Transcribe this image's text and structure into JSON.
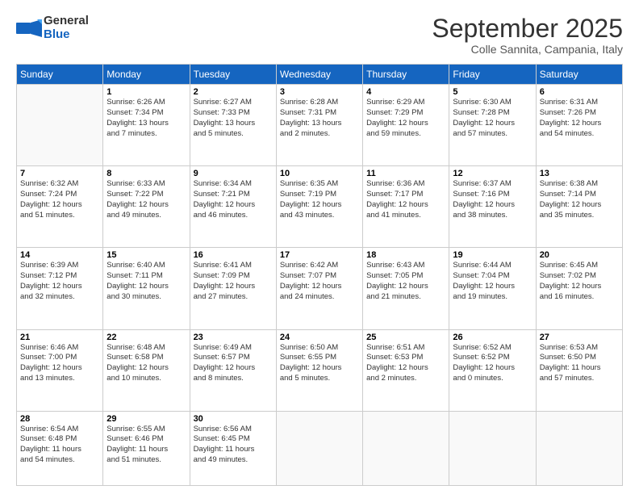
{
  "header": {
    "logo_line1": "General",
    "logo_line2": "Blue",
    "month": "September 2025",
    "location": "Colle Sannita, Campania, Italy"
  },
  "days_of_week": [
    "Sunday",
    "Monday",
    "Tuesday",
    "Wednesday",
    "Thursday",
    "Friday",
    "Saturday"
  ],
  "weeks": [
    [
      {
        "day": "",
        "info": ""
      },
      {
        "day": "1",
        "info": "Sunrise: 6:26 AM\nSunset: 7:34 PM\nDaylight: 13 hours\nand 7 minutes."
      },
      {
        "day": "2",
        "info": "Sunrise: 6:27 AM\nSunset: 7:33 PM\nDaylight: 13 hours\nand 5 minutes."
      },
      {
        "day": "3",
        "info": "Sunrise: 6:28 AM\nSunset: 7:31 PM\nDaylight: 13 hours\nand 2 minutes."
      },
      {
        "day": "4",
        "info": "Sunrise: 6:29 AM\nSunset: 7:29 PM\nDaylight: 12 hours\nand 59 minutes."
      },
      {
        "day": "5",
        "info": "Sunrise: 6:30 AM\nSunset: 7:28 PM\nDaylight: 12 hours\nand 57 minutes."
      },
      {
        "day": "6",
        "info": "Sunrise: 6:31 AM\nSunset: 7:26 PM\nDaylight: 12 hours\nand 54 minutes."
      }
    ],
    [
      {
        "day": "7",
        "info": "Sunrise: 6:32 AM\nSunset: 7:24 PM\nDaylight: 12 hours\nand 51 minutes."
      },
      {
        "day": "8",
        "info": "Sunrise: 6:33 AM\nSunset: 7:22 PM\nDaylight: 12 hours\nand 49 minutes."
      },
      {
        "day": "9",
        "info": "Sunrise: 6:34 AM\nSunset: 7:21 PM\nDaylight: 12 hours\nand 46 minutes."
      },
      {
        "day": "10",
        "info": "Sunrise: 6:35 AM\nSunset: 7:19 PM\nDaylight: 12 hours\nand 43 minutes."
      },
      {
        "day": "11",
        "info": "Sunrise: 6:36 AM\nSunset: 7:17 PM\nDaylight: 12 hours\nand 41 minutes."
      },
      {
        "day": "12",
        "info": "Sunrise: 6:37 AM\nSunset: 7:16 PM\nDaylight: 12 hours\nand 38 minutes."
      },
      {
        "day": "13",
        "info": "Sunrise: 6:38 AM\nSunset: 7:14 PM\nDaylight: 12 hours\nand 35 minutes."
      }
    ],
    [
      {
        "day": "14",
        "info": "Sunrise: 6:39 AM\nSunset: 7:12 PM\nDaylight: 12 hours\nand 32 minutes."
      },
      {
        "day": "15",
        "info": "Sunrise: 6:40 AM\nSunset: 7:11 PM\nDaylight: 12 hours\nand 30 minutes."
      },
      {
        "day": "16",
        "info": "Sunrise: 6:41 AM\nSunset: 7:09 PM\nDaylight: 12 hours\nand 27 minutes."
      },
      {
        "day": "17",
        "info": "Sunrise: 6:42 AM\nSunset: 7:07 PM\nDaylight: 12 hours\nand 24 minutes."
      },
      {
        "day": "18",
        "info": "Sunrise: 6:43 AM\nSunset: 7:05 PM\nDaylight: 12 hours\nand 21 minutes."
      },
      {
        "day": "19",
        "info": "Sunrise: 6:44 AM\nSunset: 7:04 PM\nDaylight: 12 hours\nand 19 minutes."
      },
      {
        "day": "20",
        "info": "Sunrise: 6:45 AM\nSunset: 7:02 PM\nDaylight: 12 hours\nand 16 minutes."
      }
    ],
    [
      {
        "day": "21",
        "info": "Sunrise: 6:46 AM\nSunset: 7:00 PM\nDaylight: 12 hours\nand 13 minutes."
      },
      {
        "day": "22",
        "info": "Sunrise: 6:48 AM\nSunset: 6:58 PM\nDaylight: 12 hours\nand 10 minutes."
      },
      {
        "day": "23",
        "info": "Sunrise: 6:49 AM\nSunset: 6:57 PM\nDaylight: 12 hours\nand 8 minutes."
      },
      {
        "day": "24",
        "info": "Sunrise: 6:50 AM\nSunset: 6:55 PM\nDaylight: 12 hours\nand 5 minutes."
      },
      {
        "day": "25",
        "info": "Sunrise: 6:51 AM\nSunset: 6:53 PM\nDaylight: 12 hours\nand 2 minutes."
      },
      {
        "day": "26",
        "info": "Sunrise: 6:52 AM\nSunset: 6:52 PM\nDaylight: 12 hours\nand 0 minutes."
      },
      {
        "day": "27",
        "info": "Sunrise: 6:53 AM\nSunset: 6:50 PM\nDaylight: 11 hours\nand 57 minutes."
      }
    ],
    [
      {
        "day": "28",
        "info": "Sunrise: 6:54 AM\nSunset: 6:48 PM\nDaylight: 11 hours\nand 54 minutes."
      },
      {
        "day": "29",
        "info": "Sunrise: 6:55 AM\nSunset: 6:46 PM\nDaylight: 11 hours\nand 51 minutes."
      },
      {
        "day": "30",
        "info": "Sunrise: 6:56 AM\nSunset: 6:45 PM\nDaylight: 11 hours\nand 49 minutes."
      },
      {
        "day": "",
        "info": ""
      },
      {
        "day": "",
        "info": ""
      },
      {
        "day": "",
        "info": ""
      },
      {
        "day": "",
        "info": ""
      }
    ]
  ]
}
